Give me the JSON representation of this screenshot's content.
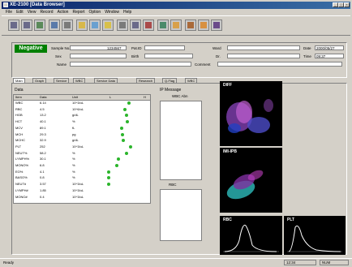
{
  "window": {
    "title": "XE-2100 [Data Browser]"
  },
  "menu": [
    "File",
    "Edit",
    "View",
    "Record",
    "Action",
    "Report",
    "Option",
    "Window",
    "Help"
  ],
  "toolbar": {
    "count": 16
  },
  "header": {
    "status": "Negative",
    "sample_no_label": "Sample No.",
    "sample_no_value": "1234567",
    "patient_id_label": "Pat.ID",
    "name_label": "Name",
    "date_label": "Date",
    "date_value": "2000/05/27",
    "time_label": "Time",
    "time_value": "09:37",
    "ward_label": "Ward",
    "dr_label": "Dr.",
    "sex_label": "Sex",
    "birth_label": "Birth",
    "comment_label": "Comment"
  },
  "tabs": [
    "Main",
    "Graph",
    "Service",
    "WBC",
    "Service Data",
    "Research",
    "Q-Flag",
    "WBC"
  ],
  "main": {
    "table_title": "Data",
    "columns": [
      "Item",
      "Data",
      "Unit",
      "L",
      "H"
    ],
    "rows": [
      {
        "item": "WBC",
        "data": "6.14",
        "unit": "10^3/uL",
        "dot": 0.55
      },
      {
        "item": "RBC",
        "data": "4.5",
        "unit": "10^6/uL",
        "dot": 0.45
      },
      {
        "item": "HGB",
        "data": "13.2",
        "unit": "g/dL",
        "dot": 0.5
      },
      {
        "item": "HCT",
        "data": "40.1",
        "unit": "%",
        "dot": 0.52
      },
      {
        "item": "MCV",
        "data": "89.1",
        "unit": "fL",
        "dot": 0.38
      },
      {
        "item": "MCH",
        "data": "29.3",
        "unit": "pg",
        "dot": 0.4
      },
      {
        "item": "MCHC",
        "data": "32.9",
        "unit": "g/dL",
        "dot": 0.42
      },
      {
        "item": "PLT",
        "data": "252",
        "unit": "10^3/uL",
        "dot": 0.6
      },
      {
        "item": "NEUT%",
        "data": "58.2",
        "unit": "%",
        "dot": 0.5
      },
      {
        "item": "LYMPH%",
        "data": "30.1",
        "unit": "%",
        "dot": 0.3
      },
      {
        "item": "MONO%",
        "data": "6.8",
        "unit": "%",
        "dot": 0.25
      },
      {
        "item": "EO%",
        "data": "4.1",
        "unit": "%",
        "dot": 0.05
      },
      {
        "item": "BASO%",
        "data": "0.8",
        "unit": "%",
        "dot": 0.05
      },
      {
        "item": "NEUT#",
        "data": "3.57",
        "unit": "10^3/uL",
        "dot": 0.05
      },
      {
        "item": "LYMPH#",
        "data": "1.85",
        "unit": "10^3/uL",
        "dot": null
      },
      {
        "item": "MONO#",
        "data": "0.4",
        "unit": "10^3/uL",
        "dot": null
      }
    ]
  },
  "flags": {
    "title": "IP Message",
    "sub1": "WBC Abn",
    "sub2": "RBC"
  },
  "graphs": {
    "diff": "DIFF",
    "imi": "IMI-IPB",
    "wbc": "RBC",
    "plt": "PLT"
  },
  "statusbar": {
    "left": "Ready",
    "right1": "12:34",
    "right2": "NUM"
  }
}
